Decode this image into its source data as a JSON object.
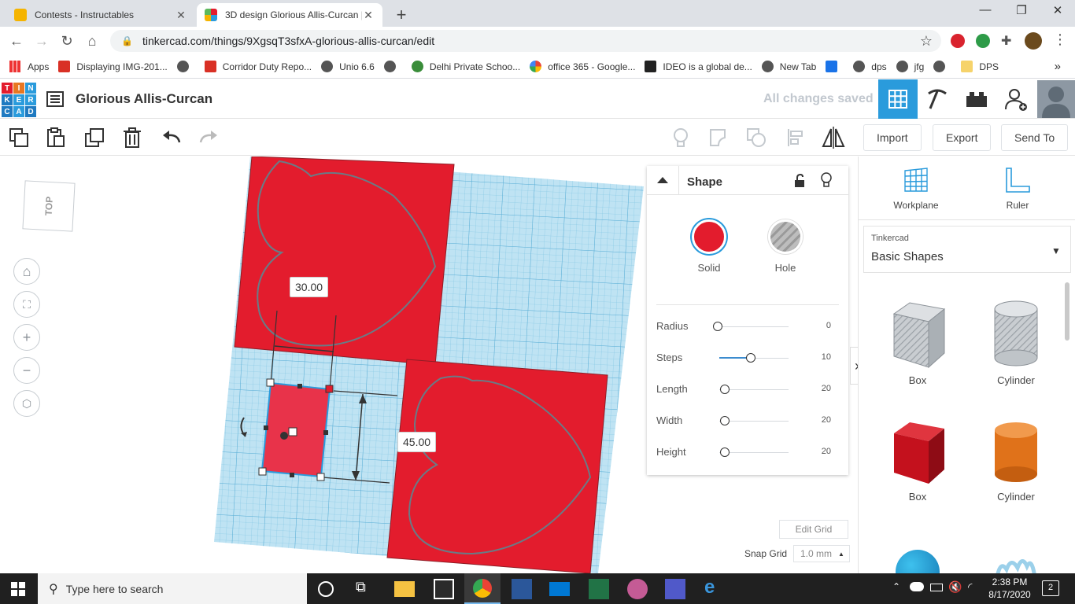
{
  "browser": {
    "tabs": [
      {
        "title": "Contests - Instructables",
        "active": false
      },
      {
        "title": "3D design Glorious Allis-Curcan | ",
        "active": true
      }
    ],
    "url": "tinkercad.com/things/9XgsqT3sfxA-glorious-allis-curcan/edit",
    "bookmarks": [
      "Apps",
      "Displaying IMG-201...",
      "Corridor Duty Repo...",
      "Unio 6.6",
      "Delhi Private Schoo...",
      "office 365 - Google...",
      "IDEO is a global de...",
      "New Tab",
      "dps",
      "jfg",
      "DPS"
    ]
  },
  "header": {
    "logo_letters": [
      "T",
      "I",
      "N",
      "K",
      "E",
      "R",
      "C",
      "A",
      "D"
    ],
    "design_title": "Glorious Allis-Curcan",
    "save_status": "All changes saved"
  },
  "toolbar": {
    "import_label": "Import",
    "export_label": "Export",
    "send_to_label": "Send To"
  },
  "viewcube": {
    "label": "TOP"
  },
  "workplane": {
    "dimension_width": "30.00",
    "dimension_length": "45.00"
  },
  "inspector": {
    "title": "Shape",
    "solid_label": "Solid",
    "hole_label": "Hole",
    "params": [
      {
        "label": "Radius",
        "value": "0",
        "fraction": 0.0
      },
      {
        "label": "Steps",
        "value": "10",
        "fraction": 0.45
      },
      {
        "label": "Length",
        "value": "20",
        "fraction": 0.08
      },
      {
        "label": "Width",
        "value": "20",
        "fraction": 0.08
      },
      {
        "label": "Height",
        "value": "20",
        "fraction": 0.08
      }
    ],
    "edit_grid_label": "Edit Grid",
    "snap_grid_label": "Snap Grid",
    "snap_grid_value": "1.0 mm"
  },
  "sidebar": {
    "workplane_label": "Workplane",
    "ruler_label": "Ruler",
    "library_category": "Tinkercad",
    "library_name": "Basic Shapes",
    "shapes": [
      {
        "label": "Box"
      },
      {
        "label": "Cylinder"
      },
      {
        "label": "Box"
      },
      {
        "label": "Cylinder"
      }
    ]
  },
  "taskbar": {
    "search_placeholder": "Type here to search",
    "time": "2:38 PM",
    "date": "8/17/2020",
    "notification_count": "2"
  },
  "colors": {
    "solid_red": "#e31c2d",
    "workplane_blue": "#9fd5ec",
    "tinkercad_blue": "#2a9bdc",
    "hole_gray": "#b0b0b0",
    "cylinder_orange": "#ee7d1d"
  }
}
